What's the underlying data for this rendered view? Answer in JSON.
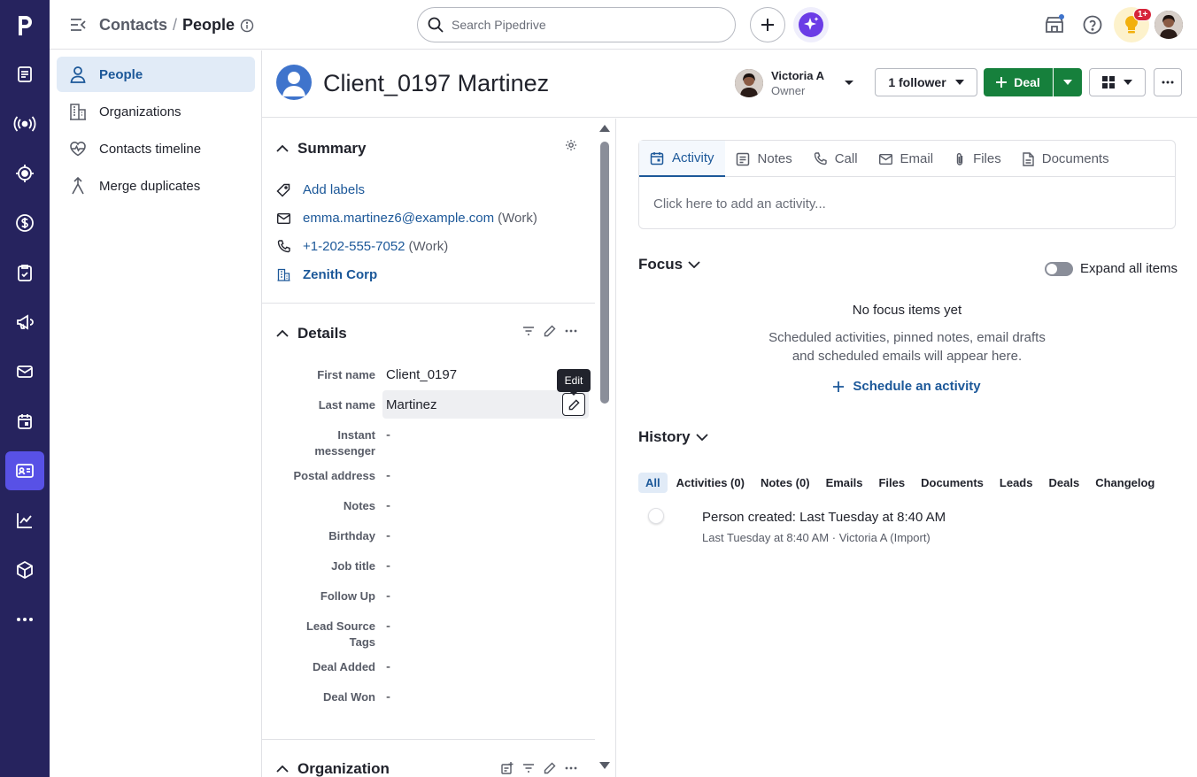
{
  "breadcrumb": {
    "parent": "Contacts",
    "separator": "/",
    "current": "People"
  },
  "search": {
    "placeholder": "Search Pipedrive"
  },
  "notifications": {
    "badge": "1+"
  },
  "left_nav": {
    "items": [
      {
        "label": "People",
        "icon": "person-icon",
        "active": true
      },
      {
        "label": "Organizations",
        "icon": "building-icon"
      },
      {
        "label": "Contacts timeline",
        "icon": "heart-pulse-icon"
      },
      {
        "label": "Merge duplicates",
        "icon": "merge-icon"
      }
    ]
  },
  "person": {
    "name": "Client_0197 Martinez"
  },
  "owner": {
    "name": "Victoria A",
    "role": "Owner"
  },
  "actions": {
    "follower": "1 follower",
    "deal": "Deal"
  },
  "summary": {
    "title": "Summary",
    "add_labels": "Add labels",
    "email": "emma.martinez6@example.com",
    "email_type": "(Work)",
    "phone": "+1-202-555-7052",
    "phone_type": "(Work)",
    "organization": "Zenith Corp"
  },
  "details": {
    "title": "Details",
    "tooltip": "Edit",
    "fields": [
      {
        "label": "First name",
        "value": "Client_0197"
      },
      {
        "label": "Last name",
        "value": "Martinez"
      },
      {
        "label": "Instant messenger",
        "value": "-"
      },
      {
        "label": "Postal address",
        "value": "-"
      },
      {
        "label": "Notes",
        "value": "-"
      },
      {
        "label": "Birthday",
        "value": "-"
      },
      {
        "label": "Job title",
        "value": "-"
      },
      {
        "label": "Follow Up",
        "value": "-"
      },
      {
        "label": "Lead Source Tags",
        "value": "-"
      },
      {
        "label": "Deal Added",
        "value": "-"
      },
      {
        "label": "Deal Won",
        "value": "-"
      }
    ]
  },
  "organization_section": {
    "title": "Organization"
  },
  "composer": {
    "tabs": [
      "Activity",
      "Notes",
      "Call",
      "Email",
      "Files",
      "Documents"
    ],
    "placeholder": "Click here to add an activity..."
  },
  "focus": {
    "title": "Focus",
    "expand_label": "Expand all items",
    "empty_title": "No focus items yet",
    "empty_line1": "Scheduled activities, pinned notes, email drafts",
    "empty_line2": "and scheduled emails will appear here.",
    "schedule_link": "Schedule an activity"
  },
  "history": {
    "title": "History",
    "filters": [
      "All",
      "Activities (0)",
      "Notes (0)",
      "Emails",
      "Files",
      "Documents",
      "Leads",
      "Deals",
      "Changelog"
    ],
    "item": {
      "title": "Person created",
      "title_time": ": Last Tuesday at 8:40 AM",
      "meta": "Last Tuesday at 8:40 AM",
      "meta_sep": "·",
      "meta_user": "Victoria A (Import)"
    }
  },
  "colors": {
    "rail": "#26235e",
    "accent": "#5851e6",
    "link": "#1c5899",
    "green": "#16803c",
    "badge": "#d6243a"
  }
}
